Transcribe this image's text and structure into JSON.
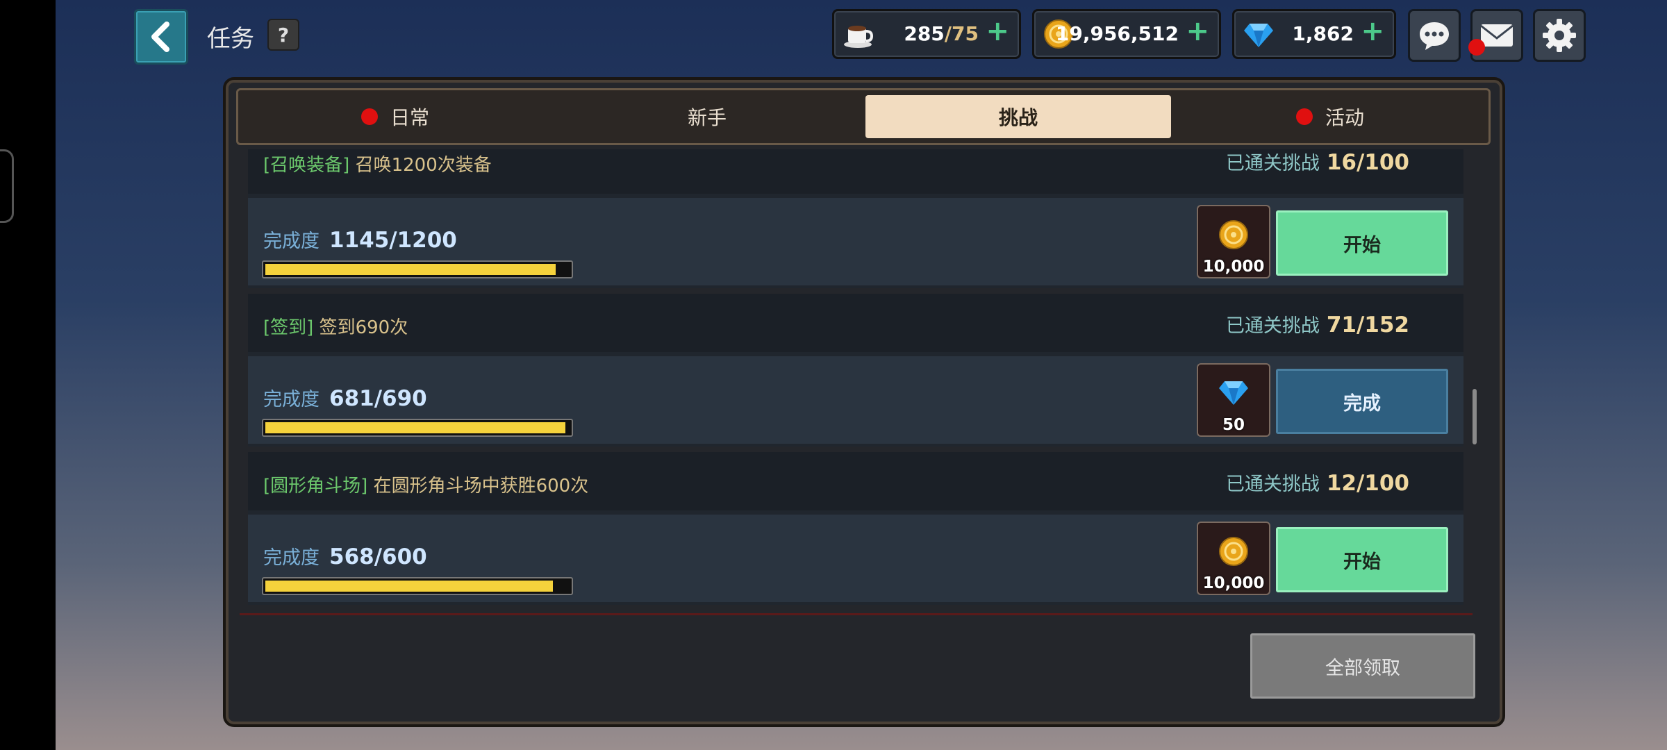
{
  "header": {
    "title": "任务",
    "help_label": "?",
    "stamina": {
      "current": "285",
      "max": "/75"
    },
    "gold": "19,956,512",
    "gems": "1,862"
  },
  "tabs": [
    {
      "label": "日常",
      "badge": true
    },
    {
      "label": "新手",
      "badge": false
    },
    {
      "label": "挑战",
      "badge": false,
      "active": true
    },
    {
      "label": "活动",
      "badge": true
    }
  ],
  "quests": [
    {
      "category": "[召唤装备]",
      "description": "召唤1200次装备",
      "cleared_label": "已通关挑战",
      "cleared": "16/100",
      "progress_label": "完成度",
      "progress": "1145/1200",
      "progress_fraction": 0.954,
      "reward_icon": "gold-coin-icon",
      "reward_amount": "10,000",
      "action": "开始",
      "action_type": "start"
    },
    {
      "category": "[签到]",
      "description": "签到690次",
      "cleared_label": "已通关挑战",
      "cleared": "71/152",
      "progress_label": "完成度",
      "progress": "681/690",
      "progress_fraction": 0.987,
      "reward_icon": "diamond-gem-icon",
      "reward_amount": "50",
      "action": "完成",
      "action_type": "done"
    },
    {
      "category": "[圆形角斗场]",
      "description": "在圆形角斗场中获胜600次",
      "cleared_label": "已通关挑战",
      "cleared": "12/100",
      "progress_label": "完成度",
      "progress": "568/600",
      "progress_fraction": 0.947,
      "reward_icon": "gold-coin-icon",
      "reward_amount": "10,000",
      "action": "开始",
      "action_type": "start"
    }
  ],
  "claim_all_label": "全部领取",
  "colors": {
    "accent_green": "#66d99a",
    "progress_yellow": "#f5d23c",
    "tab_active": "#f2dcc0",
    "badge_red": "#e01010"
  }
}
